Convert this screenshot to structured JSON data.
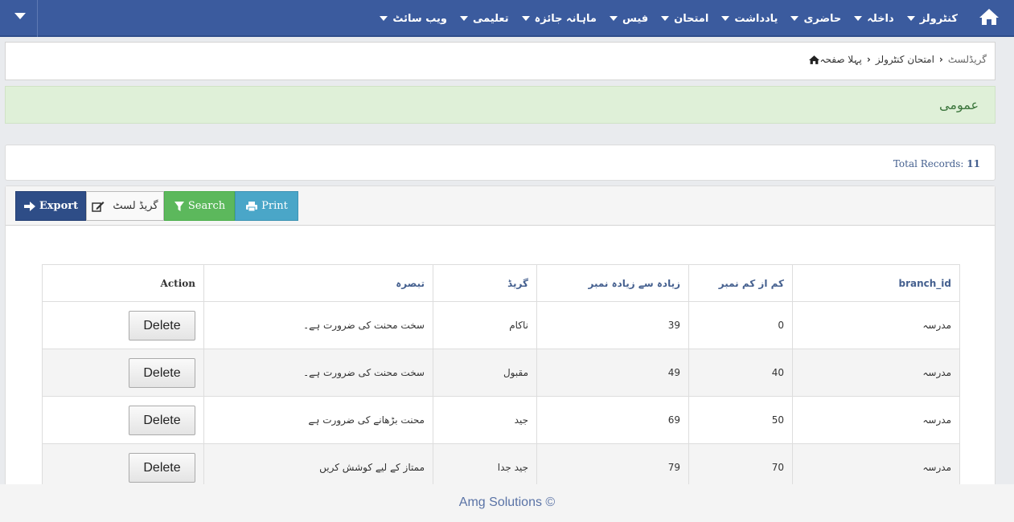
{
  "navbar": {
    "items": [
      {
        "label": "کنٹرولز"
      },
      {
        "label": "داخلہ"
      },
      {
        "label": "حاضری"
      },
      {
        "label": "یادداشت"
      },
      {
        "label": "امتحان"
      },
      {
        "label": "فیس"
      },
      {
        "label": "ماہانہ جائزہ"
      },
      {
        "label": "تعلیمی"
      },
      {
        "label": "ویب سائٹ"
      }
    ]
  },
  "breadcrumb": {
    "home": "پہلا صفحہ",
    "section": "امتحان کنٹرولز",
    "current": "گریڈلسٹ"
  },
  "alert": {
    "text": "عمومی"
  },
  "records": {
    "label": "Total Records:",
    "count": "11"
  },
  "toolbar": {
    "export": "Export",
    "gradelist": "گریڈ لسٹ",
    "search": "Search",
    "print": "Print"
  },
  "table": {
    "headers": {
      "branch_id": "branch_id",
      "min_marks": "کم از کم نمبر",
      "max_marks": "زیادہ سے زیادہ نمبر",
      "grade": "گریڈ",
      "remarks": "تبصرہ",
      "action": "Action"
    },
    "rows": [
      {
        "branch": "مدرسہ",
        "min": "0",
        "max": "39",
        "grade": "ناکام",
        "remarks": "سخت محنت کی ضرورت ہے۔",
        "action": "Delete"
      },
      {
        "branch": "مدرسہ",
        "min": "40",
        "max": "49",
        "grade": "مقبول",
        "remarks": "سخت محنت کی ضرورت ہے۔",
        "action": "Delete"
      },
      {
        "branch": "مدرسہ",
        "min": "50",
        "max": "69",
        "grade": "جید",
        "remarks": "محنت بڑھانے کی ضرورت ہے",
        "action": "Delete"
      },
      {
        "branch": "مدرسہ",
        "min": "70",
        "max": "79",
        "grade": "جید جدا",
        "remarks": "ممتاز کے لیے کوشش کریں",
        "action": "Delete"
      }
    ]
  },
  "footer": {
    "text": "Amg Solutions ©"
  }
}
